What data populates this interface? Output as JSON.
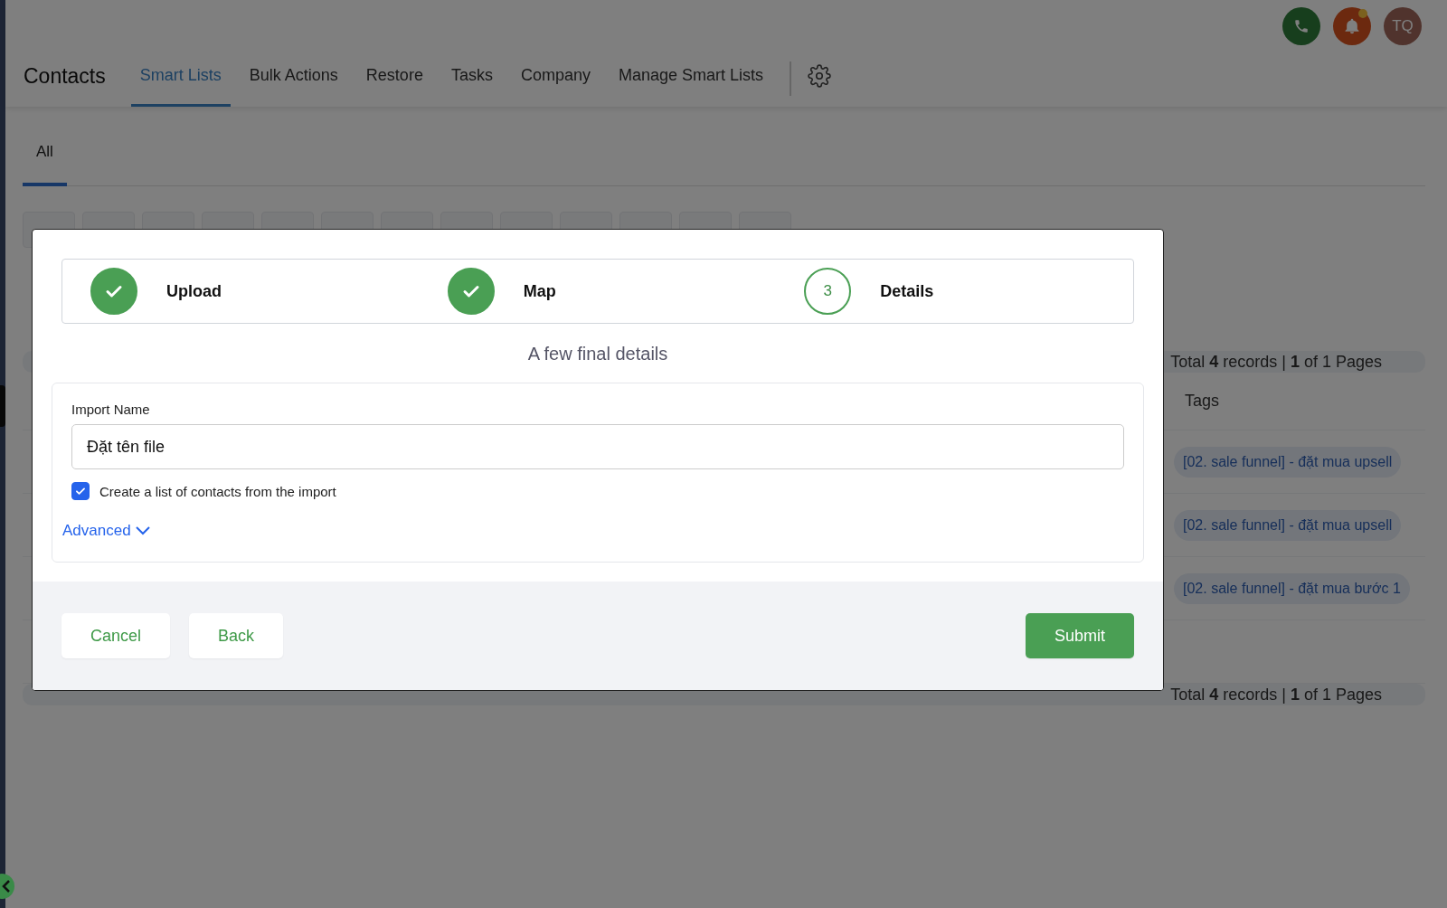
{
  "topbar": {
    "avatar": "TQ",
    "notification": true
  },
  "header": {
    "title": "Contacts",
    "tabs": [
      {
        "label": "Smart Lists",
        "selected": true
      },
      {
        "label": "Bulk Actions",
        "selected": false
      },
      {
        "label": "Restore",
        "selected": false
      },
      {
        "label": "Tasks",
        "selected": false
      },
      {
        "label": "Company",
        "selected": false
      },
      {
        "label": "Manage Smart Lists",
        "selected": false
      }
    ]
  },
  "list_tabs": [
    {
      "label": "All",
      "selected": true
    }
  ],
  "table": {
    "pagination_top": "Total **4** records | **1** of 1 Pages",
    "columns": [
      "Tags"
    ],
    "rows": [
      {
        "tags": [
          "[02. sale funnel] - đặt mua upsell"
        ]
      },
      {
        "tags": [
          "[02. sale funnel] - đặt mua upsell"
        ]
      },
      {
        "tags": [
          "[02. sale funnel] - đặt mua bước 1"
        ]
      },
      {
        "tags": []
      }
    ],
    "pagination_bottom": "Total **4** records | **1** of 1 Pages"
  },
  "modal": {
    "steps": [
      {
        "label": "Upload",
        "completed": true
      },
      {
        "label": "Map",
        "completed": true
      },
      {
        "label": "Details",
        "completed": false,
        "number": "3"
      }
    ],
    "heading": "A few final details",
    "import_name": {
      "label": "Import Name",
      "value": "Đặt tên file"
    },
    "create_list": {
      "label": "Create a list of contacts from the import",
      "checked": true
    },
    "advanced": {
      "label": "Advanced",
      "expanded": false
    },
    "buttons": [
      {
        "label": "Cancel",
        "kind": "secondary"
      },
      {
        "label": "Back",
        "kind": "secondary"
      },
      {
        "label": "Submit",
        "kind": "primary"
      }
    ]
  }
}
